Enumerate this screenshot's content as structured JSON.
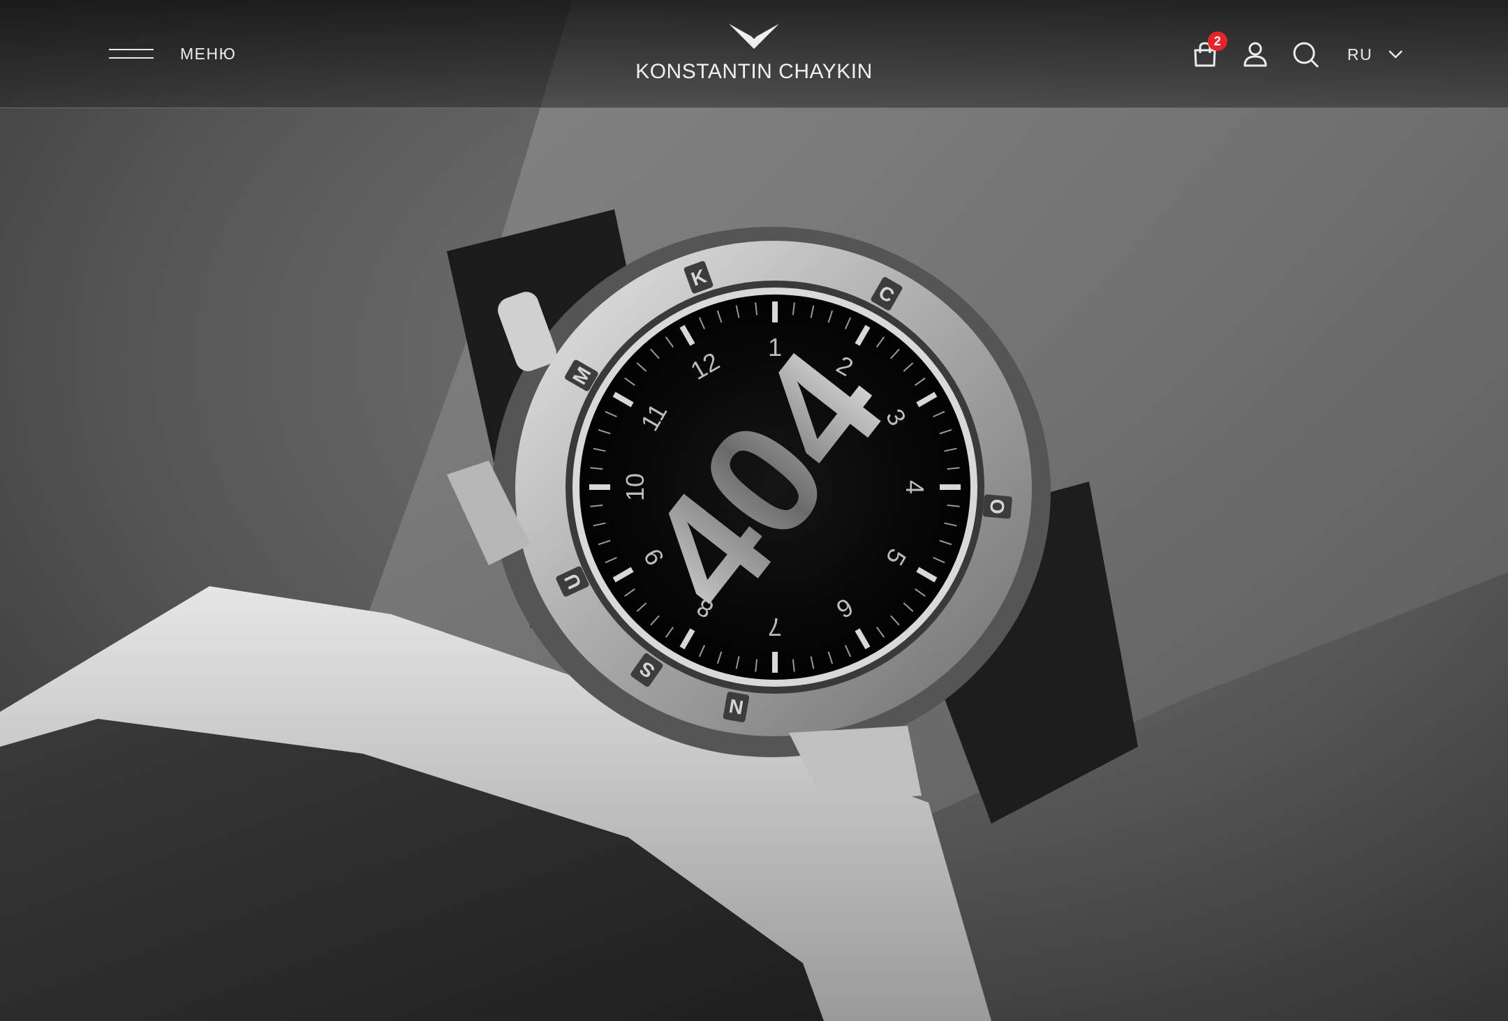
{
  "header": {
    "menu_label": "МЕНЮ",
    "brand_name": "KONSTANTIN CHAYKIN",
    "cart_count": "2",
    "language": "RU"
  },
  "icons": {
    "menu": "hamburger-icon",
    "logo": "bird-logo-icon",
    "cart": "shopping-bag-icon",
    "account": "user-icon",
    "search": "search-icon",
    "language_dropdown": "chevron-down-icon"
  },
  "hero": {
    "error_code": "404",
    "dial_numerals": [
      "1",
      "2",
      "3",
      "4",
      "5",
      "6",
      "7",
      "8",
      "9",
      "10",
      "11",
      "12"
    ],
    "bezel_letters": [
      "C",
      "O",
      "N",
      "S",
      "U",
      "M",
      "K"
    ]
  },
  "colors": {
    "badge": "#e8232a",
    "header_text": "#ececec",
    "dial": "#050505",
    "bezel": "#b9b9b9"
  }
}
